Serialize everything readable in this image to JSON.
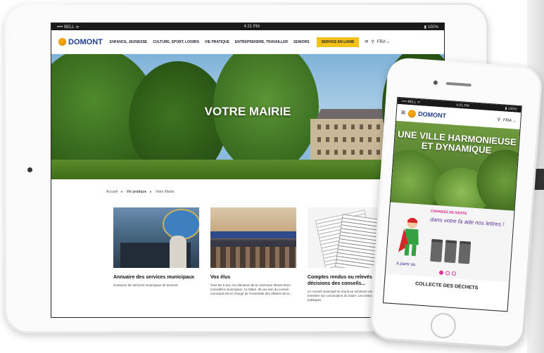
{
  "tablet": {
    "status": {
      "left": "•••• BELL ᯤ",
      "center": "4:21 PM",
      "right": "▮ 100%"
    },
    "logo": "DOMONT",
    "nav": [
      "ENFANCE, JEUNESSE",
      "CULTURE, SPORT, LOISIRS",
      "VIE PRATIQUE",
      "ENTREPRENDRE, TRAVAILLER",
      "SENIORS"
    ],
    "cta": "SERVICE EN LIGNE",
    "lang": "FRA ⌄",
    "hero_title": "VOTRE MAIRIE",
    "breadcrumb": [
      "Accueil",
      "Vie pratique",
      "Votre Mairie"
    ],
    "cards": [
      {
        "title": "Annuaire des services municipaux",
        "text": "Contacter les services municipaux de Domont."
      },
      {
        "title": "Vos élus",
        "text": "Tous les 6 ans, les électeurs de la commune élisent leurs conseillers municipaux. Le Maire, élu au sein du conseil municipal est en charge de l'ensemble des affaires de la..."
      },
      {
        "title": "Comptes rendus ou relevés de décisions des conseils...",
        "text": "Le conseil municipal se réunit au minimum une fois par trimestre sur convocation du maire. Les séances sont publiques."
      }
    ]
  },
  "phone": {
    "status": {
      "left": "•••• BELL ᯤ",
      "center": "4:21 PM",
      "right": "▮ 100%"
    },
    "logo": "DOMONT",
    "lang": "FRA ⌄",
    "hero_title": "UNE VILLE HARMONIEUSE ET DYNAMIQUE",
    "promo_head": "CHANGEZ DE GESTE",
    "promo_script": "dans votre fa ade nos lettres !",
    "promo_partir": "À partir du",
    "footer": "COLLECTE DES DÉCHETS"
  }
}
